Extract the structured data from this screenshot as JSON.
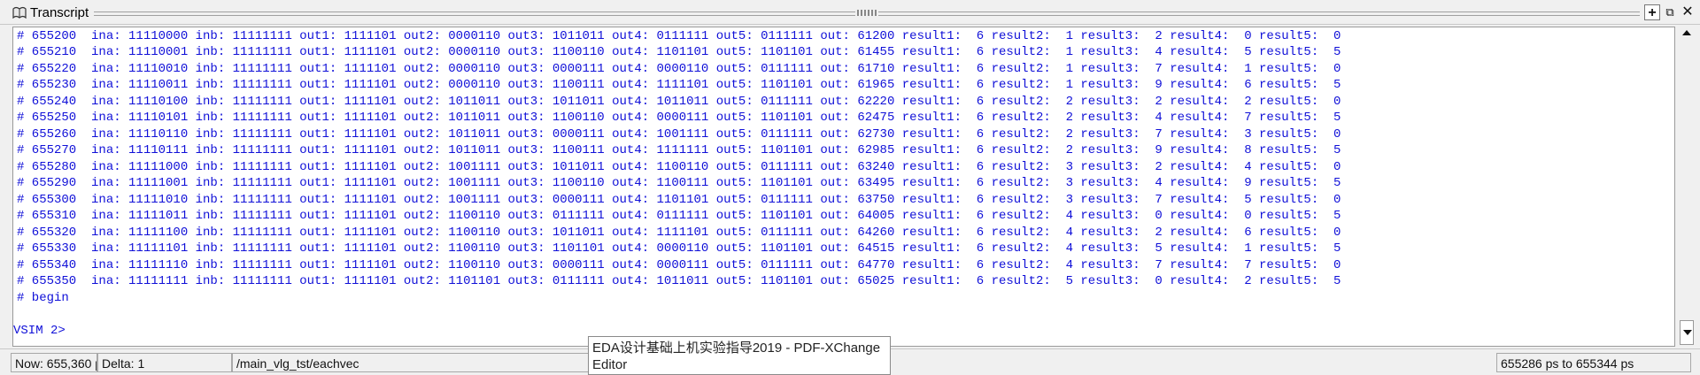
{
  "window": {
    "title": "Transcript",
    "icon": "transcript-icon"
  },
  "lines": [
    "# 655200  ina: 11110000 inb: 11111111 out1: 1111101 out2: 0000110 out3: 1011011 out4: 0111111 out5: 0111111 out: 61200 result1:  6 result2:  1 result3:  2 result4:  0 result5:  0",
    "# 655210  ina: 11110001 inb: 11111111 out1: 1111101 out2: 0000110 out3: 1100110 out4: 1101101 out5: 1101101 out: 61455 result1:  6 result2:  1 result3:  4 result4:  5 result5:  5",
    "# 655220  ina: 11110010 inb: 11111111 out1: 1111101 out2: 0000110 out3: 0000111 out4: 0000110 out5: 0111111 out: 61710 result1:  6 result2:  1 result3:  7 result4:  1 result5:  0",
    "# 655230  ina: 11110011 inb: 11111111 out1: 1111101 out2: 0000110 out3: 1100111 out4: 1111101 out5: 1101101 out: 61965 result1:  6 result2:  1 result3:  9 result4:  6 result5:  5",
    "# 655240  ina: 11110100 inb: 11111111 out1: 1111101 out2: 1011011 out3: 1011011 out4: 1011011 out5: 0111111 out: 62220 result1:  6 result2:  2 result3:  2 result4:  2 result5:  0",
    "# 655250  ina: 11110101 inb: 11111111 out1: 1111101 out2: 1011011 out3: 1100110 out4: 0000111 out5: 1101101 out: 62475 result1:  6 result2:  2 result3:  4 result4:  7 result5:  5",
    "# 655260  ina: 11110110 inb: 11111111 out1: 1111101 out2: 1011011 out3: 0000111 out4: 1001111 out5: 0111111 out: 62730 result1:  6 result2:  2 result3:  7 result4:  3 result5:  0",
    "# 655270  ina: 11110111 inb: 11111111 out1: 1111101 out2: 1011011 out3: 1100111 out4: 1111111 out5: 1101101 out: 62985 result1:  6 result2:  2 result3:  9 result4:  8 result5:  5",
    "# 655280  ina: 11111000 inb: 11111111 out1: 1111101 out2: 1001111 out3: 1011011 out4: 1100110 out5: 0111111 out: 63240 result1:  6 result2:  3 result3:  2 result4:  4 result5:  0",
    "# 655290  ina: 11111001 inb: 11111111 out1: 1111101 out2: 1001111 out3: 1100110 out4: 1100111 out5: 1101101 out: 63495 result1:  6 result2:  3 result3:  4 result4:  9 result5:  5",
    "# 655300  ina: 11111010 inb: 11111111 out1: 1111101 out2: 1001111 out3: 0000111 out4: 1101101 out5: 0111111 out: 63750 result1:  6 result2:  3 result3:  7 result4:  5 result5:  0",
    "# 655310  ina: 11111011 inb: 11111111 out1: 1111101 out2: 1100110 out3: 0111111 out4: 0111111 out5: 1101101 out: 64005 result1:  6 result2:  4 result3:  0 result4:  0 result5:  5",
    "# 655320  ina: 11111100 inb: 11111111 out1: 1111101 out2: 1100110 out3: 1011011 out4: 1111101 out5: 0111111 out: 64260 result1:  6 result2:  4 result3:  2 result4:  6 result5:  0",
    "# 655330  ina: 11111101 inb: 11111111 out1: 1111101 out2: 1100110 out3: 1101101 out4: 0000110 out5: 1101101 out: 64515 result1:  6 result2:  4 result3:  5 result4:  1 result5:  5",
    "# 655340  ina: 11111110 inb: 11111111 out1: 1111101 out2: 1100110 out3: 0000111 out4: 0000111 out5: 0111111 out: 64770 result1:  6 result2:  4 result3:  7 result4:  7 result5:  0",
    "# 655350  ina: 11111111 inb: 11111111 out1: 1111101 out2: 1101101 out3: 0111111 out4: 1011011 out5: 1101101 out: 65025 result1:  6 result2:  5 result3:  0 result4:  2 result5:  5",
    "# begin"
  ],
  "prompt": "VSIM 2>",
  "status": {
    "now": "Now: 655,360 ps",
    "delta": "Delta: 1",
    "path": "/main_vlg_tst/eachvec",
    "range": "655286 ps to 655344 ps"
  },
  "tooltip": "EDA设计基础上机实验指导2019 - PDF-XChange Editor",
  "colors": {
    "text": "#1010d8"
  }
}
